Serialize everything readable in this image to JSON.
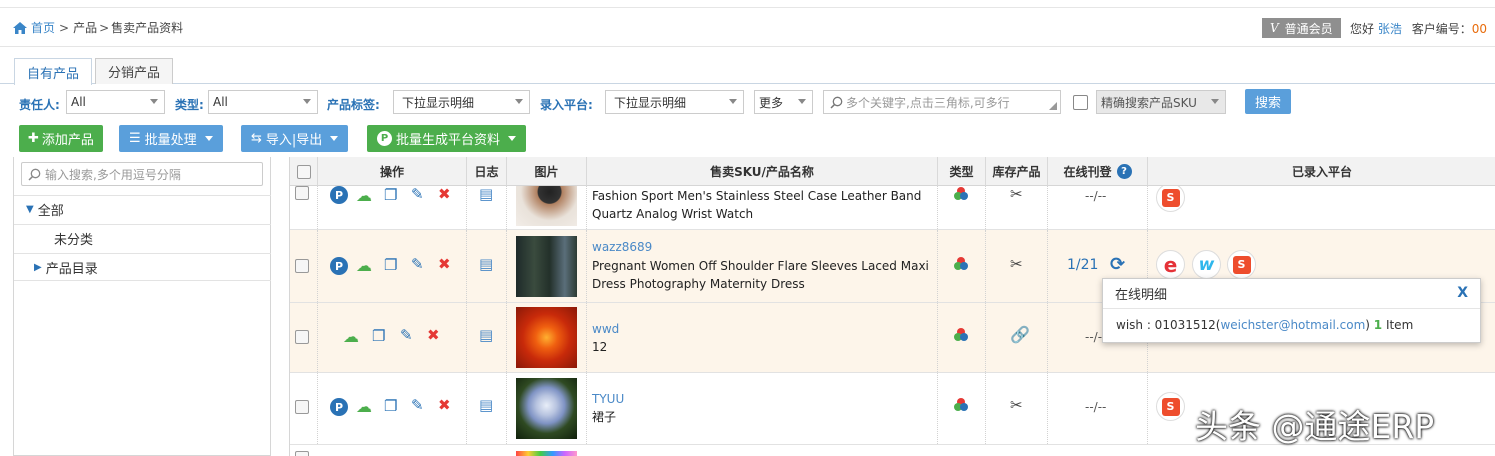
{
  "breadcrumb": {
    "home": "首页",
    "sep1": ">",
    "products": "产品",
    "sep2": ">",
    "current": "售卖产品资料"
  },
  "user": {
    "member_badge": "普通会员",
    "hello": "您好",
    "name": "张浩",
    "customer_no_label": "客户编号：",
    "customer_no": "00"
  },
  "tabs": [
    {
      "label": "自有产品"
    },
    {
      "label": "分销产品"
    }
  ],
  "filters": {
    "owner_label": "责任人:",
    "owner_value": "All",
    "type_label": "类型:",
    "type_value": "All",
    "tag_label": "产品标签:",
    "tag_value": "下拉显示明细",
    "platform_label": "录入平台:",
    "platform_value": "下拉显示明细",
    "more_value": "更多",
    "search_placeholder": "多个关键字,点击三角标,可多行",
    "exact_value": "精确搜索产品SKU",
    "search_button": "搜索"
  },
  "actions": {
    "add": "添加产品",
    "batch": "批量处理",
    "import_export": "导入|导出",
    "batch_generate": "批量生成平台资料"
  },
  "sidebar": {
    "search_placeholder": "输入搜索,多个用逗号分隔",
    "all": "全部",
    "uncategorized": "未分类",
    "catalog": "产品目录"
  },
  "columns": {
    "ops": "操作",
    "log": "日志",
    "image": "图片",
    "sku_name": "售卖SKU/产品名称",
    "type": "类型",
    "stock": "库存产品",
    "online": "在线刊登",
    "platforms": "已录入平台"
  },
  "rows": [
    {
      "sku": "",
      "name": "Fashion Sport Men's Stainless Steel Case Leather Band Quartz Analog Wrist Watch",
      "online": "--/--"
    },
    {
      "sku": "wazz8689",
      "name": "Pregnant Women Off Shoulder Flare Sleeves Laced Maxi Dress Photography Maternity Dress",
      "online": "1/21"
    },
    {
      "sku": "wwd",
      "name": "12",
      "online": "--/-"
    },
    {
      "sku": "TYUU",
      "name": "裙子",
      "online": "--/--"
    }
  ],
  "popup": {
    "title": "在线明细",
    "close": "X",
    "prefix": "wish : 01031512(",
    "email": "weichster@hotmail.com",
    "suffix": ") ",
    "count": "1",
    "unit": " Item"
  },
  "watermark": "头条 @通途ERP",
  "colors": {
    "link": "#2a72b5",
    "green": "#4cae4c",
    "blue": "#5a9fdb",
    "row_highlight": "#fdf5ea",
    "red": "#e53935"
  }
}
